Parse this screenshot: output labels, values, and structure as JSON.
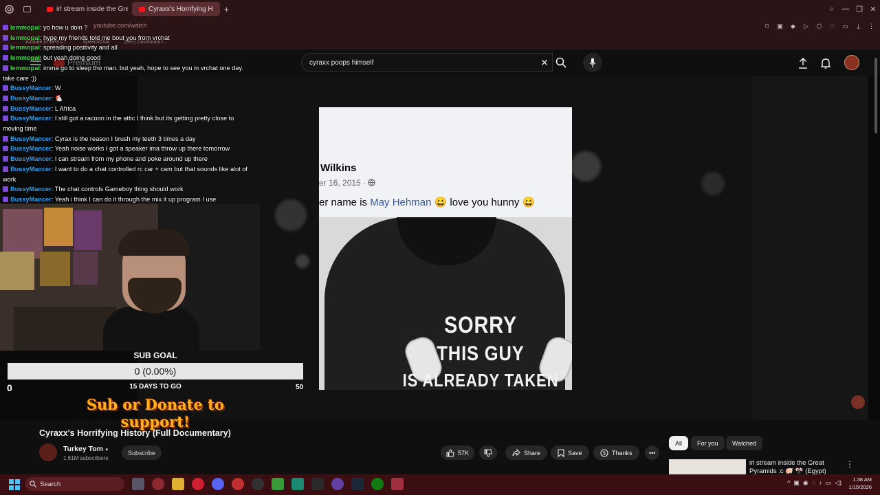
{
  "browser": {
    "tabs": [
      {
        "label": "irl stream inside the Great",
        "active": false
      },
      {
        "label": "Cyraxx's Horrifying H",
        "active": true
      }
    ],
    "url": "youtube.com/watch",
    "bookmarks": [
      "Youtube to MP3 C...",
      "SpeechChat",
      "(99+) Dashboard /..."
    ]
  },
  "youtube": {
    "logo": "Premium",
    "search_value": "cyraxx poops himself"
  },
  "chat": {
    "messages": [
      {
        "user": "lemmopal",
        "color": "lem",
        "text": "yo how u doin ?"
      },
      {
        "user": "lemmopal",
        "color": "lem",
        "text": "hype my friends told me bout you from vrchat"
      },
      {
        "user": "lemmopal",
        "color": "lem",
        "text": "spreading positivity and all"
      },
      {
        "user": "lemmopal",
        "color": "lem",
        "text": "but yeah doing good"
      },
      {
        "user": "lemmopal",
        "color": "lem",
        "text": "imma go to sleep tho man. but yeah, hope to see you in vrchat one day. take care :))"
      },
      {
        "user": "BussyMancer",
        "color": "bus",
        "text": "W"
      },
      {
        "user": "BussyMancer",
        "color": "bus",
        "text": "🐔"
      },
      {
        "user": "BussyMancer",
        "color": "bus",
        "text": "L Africa"
      },
      {
        "user": "BussyMancer",
        "color": "bus",
        "text": "I still got a racoon in the attic I think but its getting pretty close to moving time"
      },
      {
        "user": "BussyMancer",
        "color": "bus",
        "text": "Cyrax is the reason I brush my teeth 3 times a day"
      },
      {
        "user": "BussyMancer",
        "color": "bus",
        "text": "Yeah noise works I got a speaker ima throw up there tomorrow"
      },
      {
        "user": "BussyMancer",
        "color": "bus",
        "text": "I can stream from my phone and poke around up there"
      },
      {
        "user": "BussyMancer",
        "color": "bus",
        "text": "I want to do a chat controlled rc car + cam but that sounds like alot of work"
      },
      {
        "user": "BussyMancer",
        "color": "bus",
        "text": "The chat controls Gameboy thing should work"
      },
      {
        "user": "BussyMancer",
        "color": "bus",
        "text": "Yeah i think I can do it through the mix it up program I use"
      }
    ]
  },
  "sub_goal": {
    "title": "SUB GOAL",
    "value": "0 (0.00%)",
    "min": "0",
    "max": "50",
    "days": "15 DAYS TO GO",
    "progress": 0
  },
  "donate_banner": "Sub or Donate to support!",
  "post": {
    "name": "Wilkins",
    "date": "er 16, 2015 ·",
    "text_before": "er name is ",
    "link": "May Hehman",
    "text_after": " 😀 love you hunny 😀",
    "shirt_line1": "SORRY",
    "shirt_line2": "THIS GUY",
    "shirt_line3": "IS ALREADY TAKEN"
  },
  "video": {
    "title": "Cyraxx's Horrifying History (Full Documentary)",
    "channel": "Turkey Tom",
    "subscribers": "1.61M subscribers",
    "subscribe_label": "Subscribe",
    "likes": "57K",
    "share_label": "Share",
    "save_label": "Save",
    "thanks_label": "Thanks"
  },
  "filters": [
    "All",
    "For you",
    "Watched"
  ],
  "related": {
    "title": "irl stream inside the Great Pyramids :c 🐖 🎌 (Egypt)"
  },
  "taskbar": {
    "search_placeholder": "Search",
    "time": "1:38 AM",
    "date": "1/15/2026"
  },
  "colors": {
    "lemmopal": "#43d84a",
    "bussymancer": "#2fa3f2",
    "accent": "#ff0000",
    "taskbar": "#3b0f12"
  }
}
